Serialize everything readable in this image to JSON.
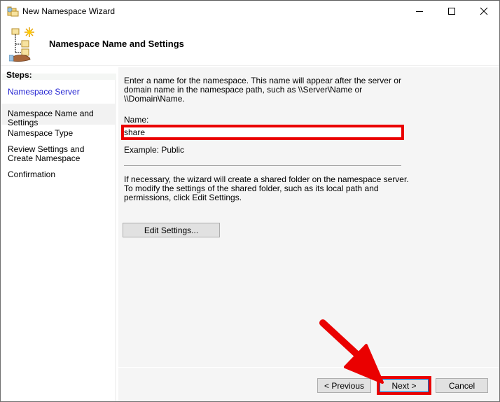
{
  "window": {
    "title": "New Namespace Wizard",
    "controls": {
      "minimize": "minimize",
      "maximize": "maximize",
      "close": "close"
    }
  },
  "header": {
    "title": "Namespace Name and Settings"
  },
  "sidebar": {
    "steps_label": "Steps:",
    "steps": [
      {
        "label": "Namespace Server",
        "state": "completed-link"
      },
      {
        "label": "Namespace Name and Settings",
        "state": "current"
      },
      {
        "label": "Namespace Type",
        "state": "pending"
      },
      {
        "label": "Review Settings and Create Namespace",
        "state": "pending"
      },
      {
        "label": "Confirmation",
        "state": "pending"
      }
    ]
  },
  "content": {
    "description": "Enter a name for the namespace. This name will appear after the server or domain name in the namespace path, such as \\\\Server\\Name or \\\\Domain\\Name.",
    "name_label": "Name:",
    "name_value": "share",
    "example": "Example: Public",
    "shared_folder_note": "If necessary, the wizard will create a shared folder on the namespace server. To modify the settings of the shared folder, such as its local path and permissions, click Edit Settings.",
    "edit_settings_button": "Edit Settings..."
  },
  "footer": {
    "previous_button": "< Previous",
    "next_button": "Next >",
    "cancel_button": "Cancel"
  },
  "annotations": {
    "highlight_color": "#ea0000",
    "highlights": [
      "name-input",
      "next-button"
    ],
    "arrow_target": "next-button"
  }
}
